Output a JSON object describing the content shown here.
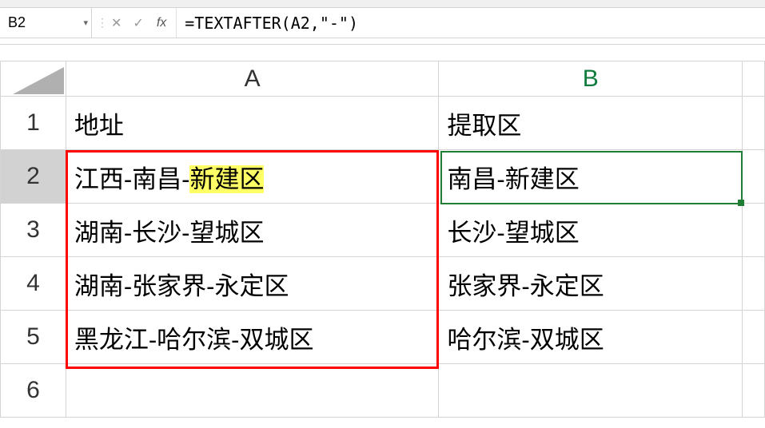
{
  "name_box": "B2",
  "formula": "=TEXTAFTER(A2,\"-\")",
  "fx_label": "fx",
  "columns": [
    "A",
    "B"
  ],
  "rows": [
    {
      "num": "1",
      "a": "地址",
      "b": "提取区"
    },
    {
      "num": "2",
      "a_pre": "江西-南昌-",
      "a_hl": "新建区",
      "b": "南昌-新建区"
    },
    {
      "num": "3",
      "a": "湖南-长沙-望城区",
      "b": "长沙-望城区"
    },
    {
      "num": "4",
      "a": "湖南-张家界-永定区",
      "b": "张家界-永定区"
    },
    {
      "num": "5",
      "a": "黑龙江-哈尔滨-双城区",
      "b": "哈尔滨-双城区"
    },
    {
      "num": "6",
      "a": "",
      "b": ""
    }
  ],
  "active_cell_ref": "B2",
  "red_range": "A2:A5",
  "colors": {
    "header_active": "#0f7b3c",
    "active_border": "#1e7e34",
    "annotation": "#ff0000",
    "highlight": "#ffff66"
  },
  "chart_data": {
    "type": "table",
    "title": "",
    "columns": [
      "地址",
      "提取区"
    ],
    "rows": [
      [
        "江西-南昌-新建区",
        "南昌-新建区"
      ],
      [
        "湖南-长沙-望城区",
        "长沙-望城区"
      ],
      [
        "湖南-张家界-永定区",
        "张家界-永定区"
      ],
      [
        "黑龙江-哈尔滨-双城区",
        "哈尔滨-双城区"
      ]
    ]
  }
}
